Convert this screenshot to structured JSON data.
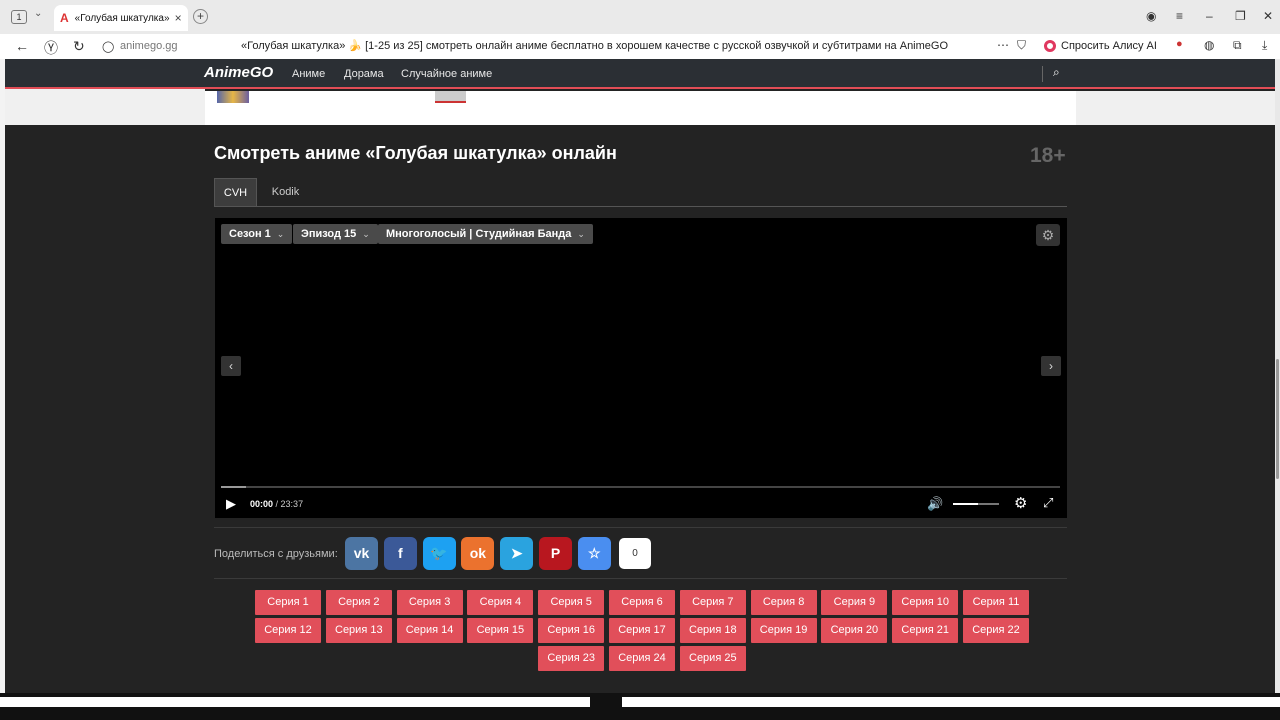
{
  "browser": {
    "tab_count": "1",
    "tab_title": "«Голубая шкатулка» 🍌",
    "address_domain": "animego.gg",
    "page_title": "«Голубая шкатулка» 🍌 [1-25 из 25] смотреть онлайн аниме бесплатно в хорошем качестве с русской озвучкой и субтитрами на AnimeGO",
    "alice_label": "Спросить Алису AI"
  },
  "header": {
    "logo": "AnimeGO",
    "nav": [
      "Аниме",
      "Дорама",
      "Случайное аниме"
    ]
  },
  "main": {
    "title": "Смотреть аниме «Голубая шкатулка» онлайн",
    "age_rating": "18+",
    "player_tabs": [
      "CVH",
      "Kodik"
    ],
    "active_player_tab": "CVH"
  },
  "player": {
    "season": "Сезон 1",
    "episode": "Эпизод 15",
    "dub": "Многоголосый | Студийная Банда",
    "current_time": "00:00",
    "duration": "/ 23:37",
    "progress": 0.03,
    "volume": 0.55
  },
  "share": {
    "label": "Поделиться с друзьями:",
    "count": "0",
    "buttons": [
      {
        "name": "vk",
        "glyph": "vk",
        "color": "#4c75a3"
      },
      {
        "name": "facebook",
        "glyph": "f",
        "color": "#3b5998"
      },
      {
        "name": "twitter",
        "glyph": "🐦",
        "color": "#1da1f2"
      },
      {
        "name": "odnoklassniki",
        "glyph": "ok",
        "color": "#eb722e"
      },
      {
        "name": "telegram",
        "glyph": "➤",
        "color": "#2aa3df"
      },
      {
        "name": "pinterest",
        "glyph": "P",
        "color": "#b8171f"
      },
      {
        "name": "bookmark",
        "glyph": "☆",
        "color": "#4a8ef0"
      }
    ]
  },
  "episodes": [
    "Серия 1",
    "Серия 2",
    "Серия 3",
    "Серия 4",
    "Серия 5",
    "Серия 6",
    "Серия 7",
    "Серия 8",
    "Серия 9",
    "Серия 10",
    "Серия 11",
    "Серия 12",
    "Серия 13",
    "Серия 14",
    "Серия 15",
    "Серия 16",
    "Серия 17",
    "Серия 18",
    "Серия 19",
    "Серия 20",
    "Серия 21",
    "Серия 22",
    "Серия 23",
    "Серия 24",
    "Серия 25"
  ]
}
